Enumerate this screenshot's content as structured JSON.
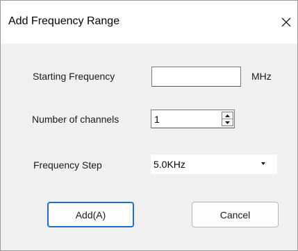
{
  "dialog": {
    "title": "Add Frequency Range",
    "close_icon": "close-icon"
  },
  "form": {
    "starting_frequency": {
      "label": "Starting Frequency",
      "value": "",
      "unit": "MHz"
    },
    "number_of_channels": {
      "label": "Number of channels",
      "value": "1"
    },
    "frequency_step": {
      "label": "Frequency Step",
      "selected": "5.0KHz"
    }
  },
  "buttons": {
    "add": "Add(A)",
    "cancel": "Cancel"
  },
  "colors": {
    "accent": "#1b6fc4",
    "dialog_background": "#f0f0f0",
    "titlebar_background": "#ffffff"
  }
}
